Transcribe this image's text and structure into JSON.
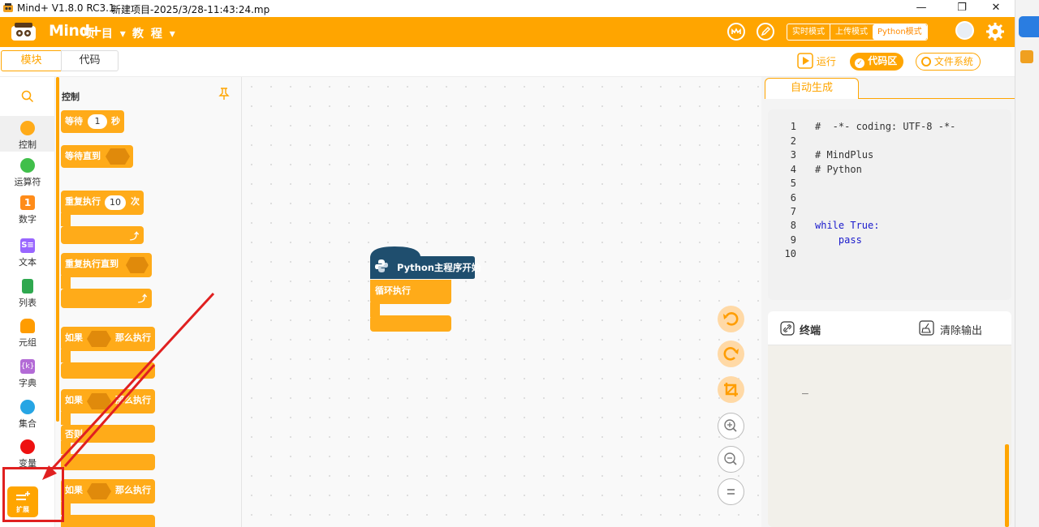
{
  "window": {
    "app_title": "Mind+ V1.8.0 RC3.1",
    "project_title": "新建项目-2025/3/28-11:43:24.mp",
    "minimize": "—",
    "restore": "❐",
    "close": "✕"
  },
  "nav": {
    "logo": "Mind+",
    "menu_project": "项 目 ▾",
    "menu_tutorial": "教 程 ▾",
    "modes": [
      "实时模式",
      "上传模式",
      "Python模式"
    ],
    "active_mode": "Python模式"
  },
  "tabs": {
    "blocks": "模块",
    "code": "代码"
  },
  "toolbar": {
    "run": "运行",
    "code_area": "代码区",
    "file_system": "文件系统"
  },
  "categories": [
    {
      "label": "控制",
      "color": "#ffab19"
    },
    {
      "label": "运算符",
      "color": "#40bf4a"
    },
    {
      "label": "数字",
      "color": "#ff8c1a"
    },
    {
      "label": "文本",
      "color": "#9966ff"
    },
    {
      "label": "列表",
      "color": "#2fa84f"
    },
    {
      "label": "元组",
      "color": "#ff9c00"
    },
    {
      "label": "字典",
      "color": "#b36bd6"
    },
    {
      "label": "集合",
      "color": "#26a5e4"
    },
    {
      "label": "变量",
      "color": "#ee1111"
    }
  ],
  "extension": {
    "label": "扩展"
  },
  "palette": {
    "heading": "控制",
    "wait": "等待",
    "wait_value": "1",
    "seconds": "秒",
    "wait_until": "等待直到",
    "repeat": "重复执行",
    "repeat_value": "10",
    "times": "次",
    "repeat_until": "重复执行直到",
    "if": "如果",
    "then": "那么执行",
    "else": "否则"
  },
  "canvas": {
    "hat_label": "Python主程序开始",
    "loop_label": "循环执行"
  },
  "code_panel": {
    "tab": "自动生成",
    "line_numbers": [
      "1",
      "2",
      "3",
      "4",
      "5",
      "6",
      "7",
      "8",
      "9",
      "10"
    ],
    "lines": [
      "#  -*- coding: UTF-8 -*-",
      "",
      "# MindPlus",
      "# Python",
      "",
      "",
      "",
      "while True:",
      "    pass",
      ""
    ]
  },
  "terminal": {
    "title": "终端",
    "clear": "清除输出",
    "cursor": "_"
  },
  "colors": {
    "accent": "#ffa500",
    "block": "#ffab19",
    "python_hat": "#1f4e6e",
    "annotation": "#e02020"
  }
}
